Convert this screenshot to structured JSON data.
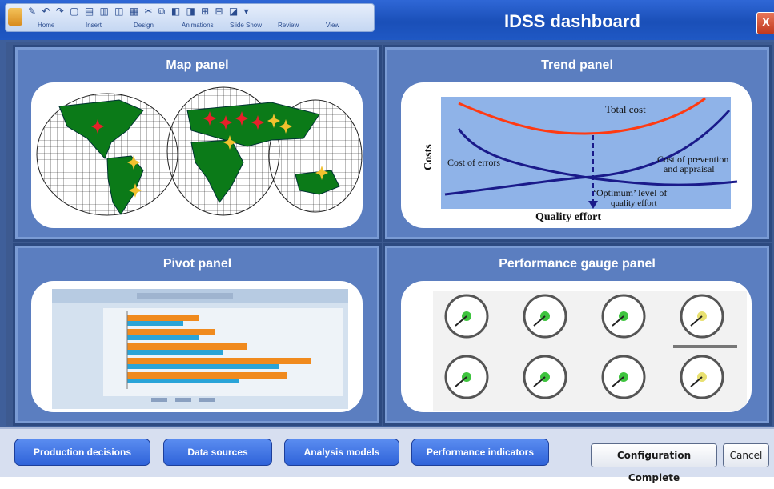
{
  "window": {
    "title": "IDSS dashboard",
    "close_label": "X",
    "ribbon_tabs": [
      "Home",
      "Insert",
      "Design",
      "Animations",
      "Slide Show",
      "Review",
      "View"
    ]
  },
  "panels": {
    "map": {
      "title": "Map panel"
    },
    "trend": {
      "title": "Trend panel",
      "labels": {
        "total_cost": "Total cost",
        "costs": "Costs",
        "cost_errors": "Cost of errors",
        "cost_prevention_1": "Cost of prevention",
        "cost_prevention_2": "and appraisal",
        "optimum_1": "‘Optimum’ level of",
        "optimum_2": "quality effort",
        "quality_effort": "Quality effort"
      }
    },
    "pivot": {
      "title": "Pivot panel"
    },
    "gauge": {
      "title": "Performance gauge panel"
    }
  },
  "buttons": {
    "production": "Production decisions",
    "sources": "Data sources",
    "models": "Analysis models",
    "indicators": "Performance indicators",
    "config": "Configuration Complete",
    "cancel": "Cancel"
  },
  "colors": {
    "accent_blue": "#2f63d9",
    "panel_blue": "#5b7ec0",
    "continent_green": "#0b7a18",
    "star_red": "#e8202a",
    "star_gold": "#f2c12e",
    "trend_bg": "#8fb3e8",
    "total_cost_line": "#ff3a12",
    "curve_dark": "#1a1a8a"
  }
}
